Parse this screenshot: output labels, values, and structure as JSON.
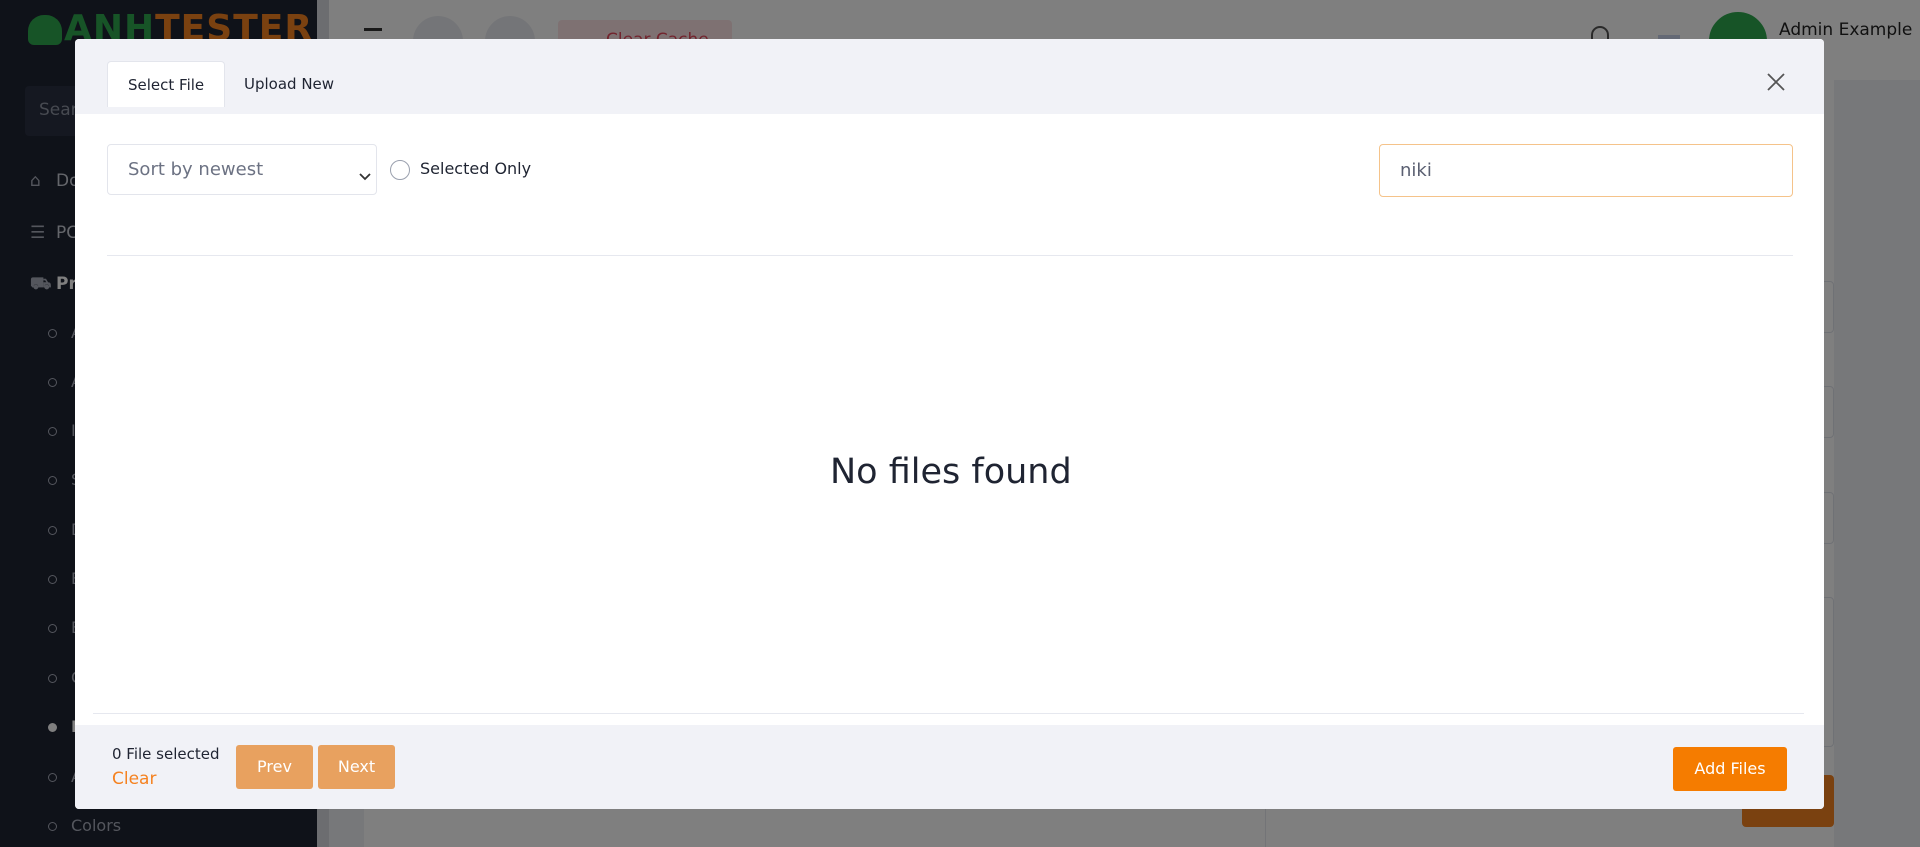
{
  "background": {
    "logo": {
      "part1": "ANH",
      "part2": "TESTER"
    },
    "sidebar": {
      "search_placeholder": "Sear",
      "items": [
        {
          "label": "Do",
          "icon": "home-icon"
        },
        {
          "label": "PC",
          "icon": "list-icon"
        },
        {
          "label": "Pro",
          "icon": "cart-icon"
        }
      ],
      "subitems": [
        "A",
        "A",
        "In",
        "S",
        "D",
        "B",
        "B",
        "C",
        "B",
        "A",
        "Colors"
      ]
    },
    "topbar": {
      "clear_cache": "Clear Cache",
      "user_name": "Admin Example"
    }
  },
  "modal": {
    "tabs": [
      {
        "label": "Select File",
        "active": true
      },
      {
        "label": "Upload New",
        "active": false
      }
    ],
    "toolbar": {
      "sort_value": "Sort by newest",
      "selected_only_label": "Selected Only",
      "search_value": "niki"
    },
    "empty_message": "No files found",
    "footer": {
      "selected_count": "0 File selected",
      "clear_label": "Clear",
      "prev_label": "Prev",
      "next_label": "Next",
      "add_files_label": "Add Files"
    }
  },
  "colors": {
    "accent": "#f57c00",
    "pager_button": "#e8a15f",
    "sidebar_bg": "#1f2432",
    "brand_green": "#2fa84f"
  }
}
